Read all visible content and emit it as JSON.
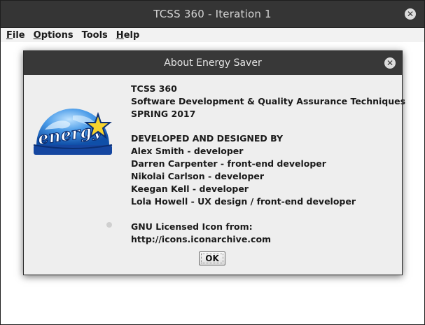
{
  "window": {
    "title": "TCSS 360 - Iteration 1",
    "close_icon": "close-icon"
  },
  "menubar": {
    "items": [
      {
        "mnemonic": "F",
        "rest": "ile"
      },
      {
        "mnemonic": "O",
        "rest": "ptions"
      },
      {
        "mnemonic": "",
        "rest": "Tools"
      },
      {
        "mnemonic": "H",
        "rest": "elp"
      }
    ]
  },
  "dialog": {
    "title": "About Energy Saver",
    "logo_icon": "energy-star-logo",
    "logo_text": "energy",
    "lines": [
      "TCSS 360",
      "Software Development & Quality Assurance Techniques",
      "SPRING 2017",
      "",
      "DEVELOPED AND DESIGNED BY",
      "Alex Smith - developer",
      "Darren Carpenter - front-end developer",
      "Nikolai Carlson - developer",
      "Keegan Kell - developer",
      "Lola Howell - UX design / front-end developer",
      "",
      "GNU Licensed Icon from:",
      "http://icons.iconarchive.com"
    ],
    "ok_label": "OK"
  },
  "colors": {
    "titlebar": "#353535",
    "dialog_bg": "#eeeeee",
    "energy_blue": "#1a5fb4",
    "energy_yellow": "#f6d32d"
  }
}
